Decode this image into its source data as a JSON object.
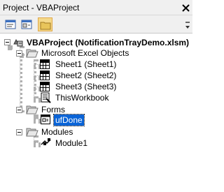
{
  "window": {
    "title": "Project - VBAProject"
  },
  "toolbar": {
    "buttons": [
      {
        "name": "view-code-button",
        "icon": "view-code-icon"
      },
      {
        "name": "view-object-button",
        "icon": "view-object-icon"
      },
      {
        "name": "toggle-folders-button",
        "icon": "folder-icon",
        "active": true
      }
    ]
  },
  "tree": {
    "project": "VBAProject (NotificationTrayDemo.xlsm)",
    "excel_objects_folder": "Microsoft Excel Objects",
    "sheets": [
      "Sheet1 (Sheet1)",
      "Sheet2 (Sheet2)",
      "Sheet3 (Sheet3)"
    ],
    "workbook": "ThisWorkbook",
    "forms_folder": "Forms",
    "form": "ufDone",
    "modules_folder": "Modules",
    "module": "Module1"
  },
  "colors": {
    "selection": "#0a64d7",
    "folder": "#e8c45a",
    "active_button": "#f5d98a"
  }
}
